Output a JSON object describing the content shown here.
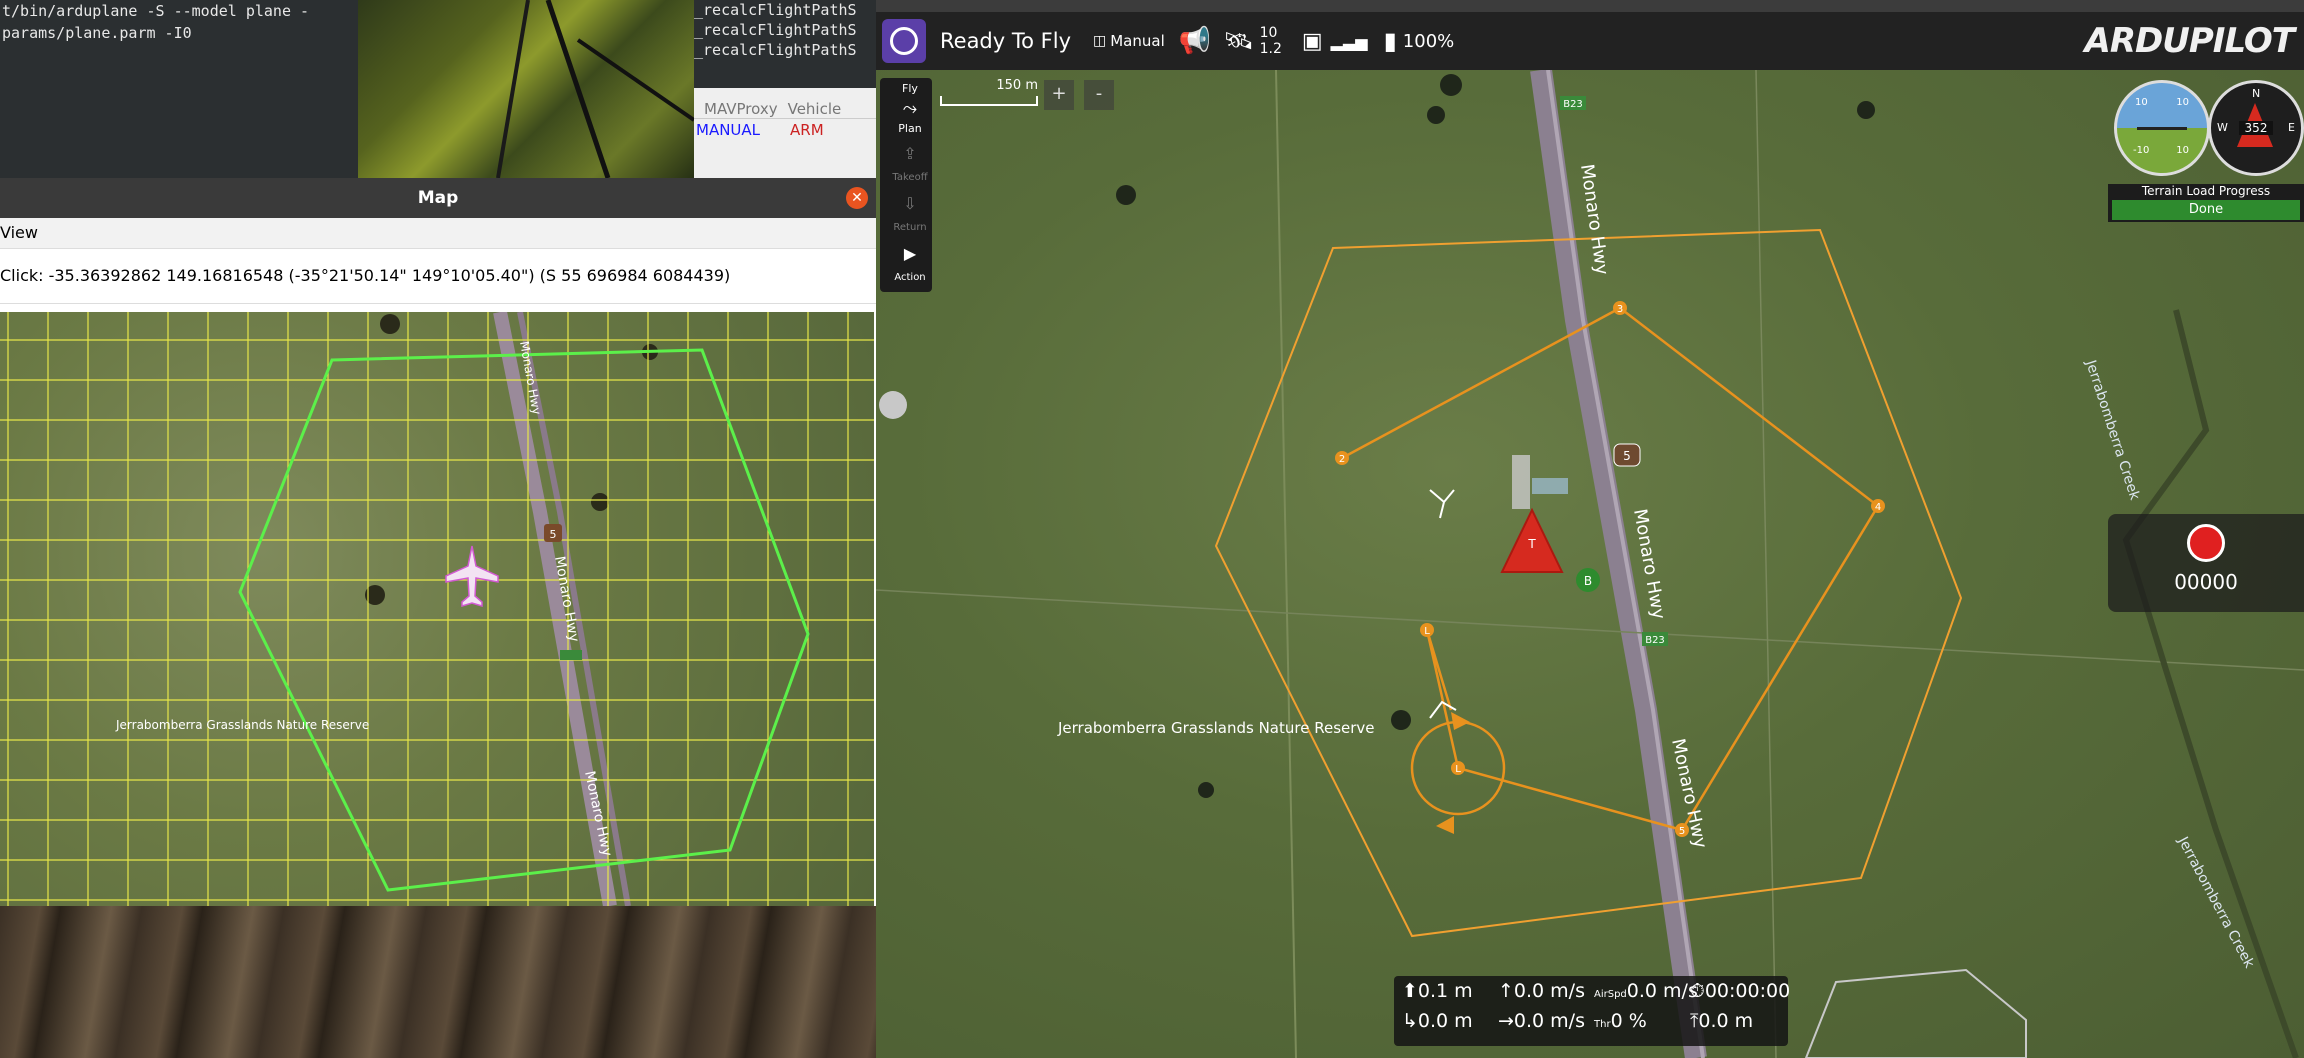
{
  "terminal_left": {
    "lines": [
      "t/bin/arduplane -S --model plane -",
      "params/plane.parm -I0"
    ]
  },
  "terminal_right": {
    "lines": [
      "_recalcFlightPathS",
      "_recalcFlightPathS",
      "_recalcFlightPathS"
    ]
  },
  "mavproxy": {
    "tabs": [
      "MAVProxy",
      "Vehicle"
    ],
    "mode": "MANUAL",
    "arm": "ARM",
    "mode_color": "#1a1aff",
    "arm_color": "#cc2222"
  },
  "map_window": {
    "title": "Map",
    "menu_view": "View",
    "click_text": "Click: -35.36392862 149.16816548 (-35°21'50.14\" 149°10'05.40\") (S 55 696984 6084439)",
    "road_labels": [
      "Monaro Hwy",
      "Monaro Hwy",
      "Monaro Hwy"
    ],
    "reserve_label": "Jerrabomberra Grasslands Nature Reserve",
    "shield": "5",
    "shield_b": "B23",
    "fence_color": "#5cf04a",
    "grid_color": "#e6e64a"
  },
  "qgc": {
    "status": "Ready To Fly",
    "flight_mode": "Manual",
    "sat_count": "10",
    "hdop": "1.2",
    "battery": "100%",
    "logo": "ARDUPILOT",
    "scale_label": "150 m",
    "zoom_in": "+",
    "zoom_out": "-",
    "tools": [
      {
        "label": "Fly",
        "active": true
      },
      {
        "label": "Plan",
        "active": true
      },
      {
        "label": "Takeoff",
        "active": false
      },
      {
        "label": "Return",
        "active": false
      },
      {
        "label": "Action",
        "active": true
      }
    ],
    "attitude": {
      "top_left": "10",
      "top_right": "10",
      "bottom_left": "-10",
      "bottom_right": "10"
    },
    "compass": {
      "n": "N",
      "w": "W",
      "e": "E",
      "heading": "352"
    },
    "terrain_title": "Terrain Load Progress",
    "terrain_status": "Done",
    "record_counter": "00000",
    "map_labels": {
      "hwy1": "Monaro Hwy",
      "hwy2": "Monaro Hwy",
      "hwy3": "Monaro Hwy",
      "creek1": "Jerrabomberra Creek",
      "creek2": "Jerrabomberra Creek",
      "reserve": "Jerrabomberra Grasslands Nature Reserve",
      "b23_top": "B23",
      "b23_mid": "B23",
      "shield": "5"
    },
    "waypoints": [
      "2",
      "3",
      "4",
      "5",
      "L",
      "L",
      "T",
      "B"
    ],
    "route_color": "#e8921e",
    "telemetry": {
      "alt": "0.1 m",
      "vspeed": "0.0 m/s",
      "airspeed_label": "AirSpd",
      "airspeed": "0.0 m/s",
      "time": "00:00:00",
      "dist": "0.0 m",
      "gspeed": "0.0 m/s",
      "thr_label": "Thr",
      "throttle": "0 %",
      "home_dist": "0.0 m"
    }
  }
}
